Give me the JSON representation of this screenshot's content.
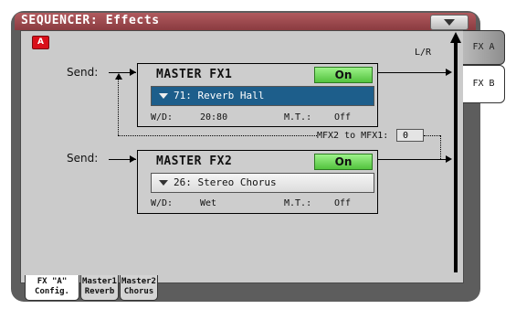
{
  "title": "SEQUENCER: Effects",
  "panel_badge": "A",
  "lr_label": "L/R",
  "send_label": "Send:",
  "fx1": {
    "name": "MASTER FX1",
    "state": "On",
    "preset": "71: Reverb Hall",
    "wd_label": "W/D:",
    "wd_value": "20:80",
    "mt_label": "M.T.:",
    "mt_value": "Off"
  },
  "fx2": {
    "name": "MASTER FX2",
    "state": "On",
    "preset": "26: Stereo Chorus",
    "wd_label": "W/D:",
    "wd_value": "Wet",
    "mt_label": "M.T.:",
    "mt_value": "Off"
  },
  "mfx2_to_mfx1": {
    "label": "MFX2 to MFX1:",
    "value": "0"
  },
  "side_tabs": [
    "FX A",
    "FX B"
  ],
  "bottom_tabs": [
    {
      "line1": "FX \"A\"",
      "line2": "Config."
    },
    {
      "line1": "Master1",
      "line2": "Reverb"
    },
    {
      "line1": "Master2",
      "line2": "Chorus"
    }
  ],
  "colors": {
    "title_bar": "#9c4a4f",
    "selected": "#1d5e8b",
    "on_button": "#6ad655",
    "badge": "#d9101a"
  }
}
